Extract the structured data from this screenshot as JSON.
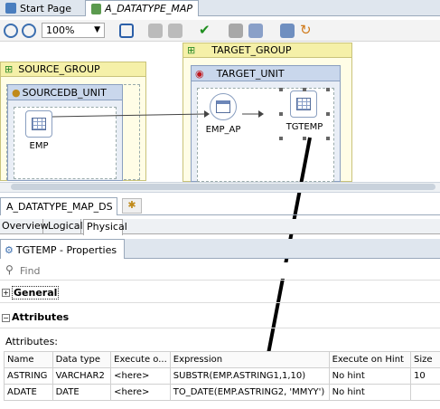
{
  "tabs": [
    {
      "label": "Start Page"
    },
    {
      "label": "A_DATATYPE_MAP"
    }
  ],
  "toolbar": {
    "zoom": "100%"
  },
  "diagram": {
    "source_group": "SOURCE_GROUP",
    "source_unit": "SOURCEDB_UNIT",
    "source_node": "EMP",
    "target_group": "TARGET_GROUP",
    "target_unit": "TARGET_UNIT",
    "ap_node": "EMP_AP",
    "target_node": "TGTEMP"
  },
  "lower_tabs": {
    "ds_tab": "A_DATATYPE_MAP_DS",
    "overview": "Overview",
    "logical": "Logical",
    "physical": "Physical"
  },
  "properties": {
    "title": "TGTEMP - Properties",
    "find_placeholder": "Find",
    "general": "General",
    "attributes": "Attributes",
    "attributes_label": "Attributes:",
    "columns": [
      "Name",
      "Data type",
      "Execute o...",
      "Expression",
      "Execute on Hint",
      "Size"
    ],
    "rows": [
      [
        "ASTRING",
        "VARCHAR2",
        "<here>",
        "SUBSTR(EMP.ASTRING1,1,10)",
        "No hint",
        "10"
      ],
      [
        "ADATE",
        "DATE",
        "<here>",
        "TO_DATE(EMP.ASTRING2, 'MMYY')",
        "No hint",
        ""
      ]
    ]
  },
  "colors": {
    "accent": "#c9d7ec",
    "group": "#f5f0a8"
  }
}
